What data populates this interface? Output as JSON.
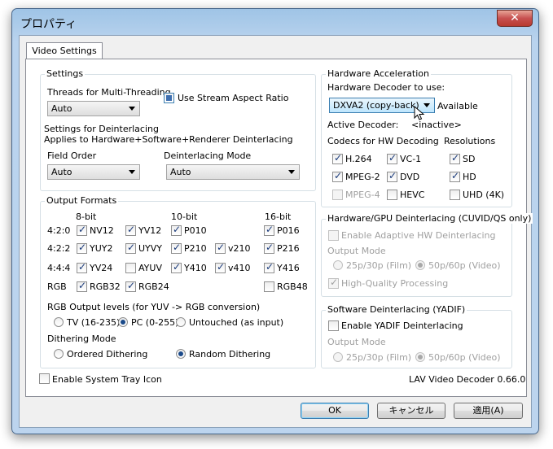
{
  "window": {
    "title": "プロパティ",
    "close_glyph": "✕"
  },
  "tab": {
    "label": "Video Settings"
  },
  "settings": {
    "title": "Settings",
    "threads_label": "Threads for Multi-Threading",
    "threads_value": "Auto",
    "stream_aspect_label": "Use Stream Aspect Ratio",
    "deint_title": "Settings for Deinterlacing",
    "deint_desc": "Applies to Hardware+Software+Renderer Deinterlacing",
    "field_order_label": "Field Order",
    "field_order_value": "Auto",
    "deint_mode_label": "Deinterlacing Mode",
    "deint_mode_value": "Auto"
  },
  "output_formats": {
    "title": "Output Formats",
    "col_8bit": "8-bit",
    "col_10bit": "10-bit",
    "col_16bit": "16-bit",
    "rows": [
      {
        "label": "4:2:0",
        "items": [
          "NV12",
          "YV12",
          "P010",
          "P016"
        ]
      },
      {
        "label": "4:2:2",
        "items": [
          "YUY2",
          "UYVY",
          "P210",
          "v210",
          "P216"
        ]
      },
      {
        "label": "4:4:4",
        "items": [
          "YV24",
          "AYUV",
          "Y410",
          "v410",
          "Y416"
        ]
      },
      {
        "label": "RGB",
        "items": [
          "RGB32",
          "RGB24",
          "RGB48"
        ]
      }
    ],
    "rgb_levels_label": "RGB Output levels (for YUV -> RGB conversion)",
    "rgb_levels": [
      "TV (16-235)",
      "PC (0-255)",
      "Untouched (as input)"
    ],
    "dithering_label": "Dithering Mode",
    "dithering": [
      "Ordered Dithering",
      "Random Dithering"
    ]
  },
  "hw": {
    "title": "Hardware Acceleration",
    "decoder_label": "Hardware Decoder to use:",
    "decoder_value": "DXVA2 (copy-back)",
    "status": "Available",
    "active_label": "Active Decoder:",
    "active_value": "<inactive>",
    "codecs_label": "Codecs for HW Decoding",
    "codecs": [
      "H.264",
      "VC-1",
      "MPEG-2",
      "DVD",
      "MPEG-4",
      "HEVC"
    ],
    "res_label": "Resolutions",
    "resolutions": [
      "SD",
      "HD",
      "UHD (4K)"
    ]
  },
  "hwdeint": {
    "title": "Hardware/GPU Deinterlacing (CUVID/QS only)",
    "adaptive_label": "Enable Adaptive HW Deinterlacing",
    "output_mode_label": "Output Mode",
    "modes": [
      "25p/30p (Film)",
      "50p/60p (Video)"
    ],
    "hq_label": "High-Quality Processing"
  },
  "swdeint": {
    "title": "Software Deinterlacing (YADIF)",
    "enable_label": "Enable YADIF Deinterlacing",
    "output_mode_label": "Output Mode",
    "modes": [
      "25p/30p (Film)",
      "50p/60p (Video)"
    ]
  },
  "footer": {
    "tray_label": "Enable System Tray Icon",
    "version": "LAV Video Decoder 0.66.0"
  },
  "buttons": {
    "ok": "OK",
    "cancel": "キャンセル",
    "apply": "適用(A)"
  }
}
